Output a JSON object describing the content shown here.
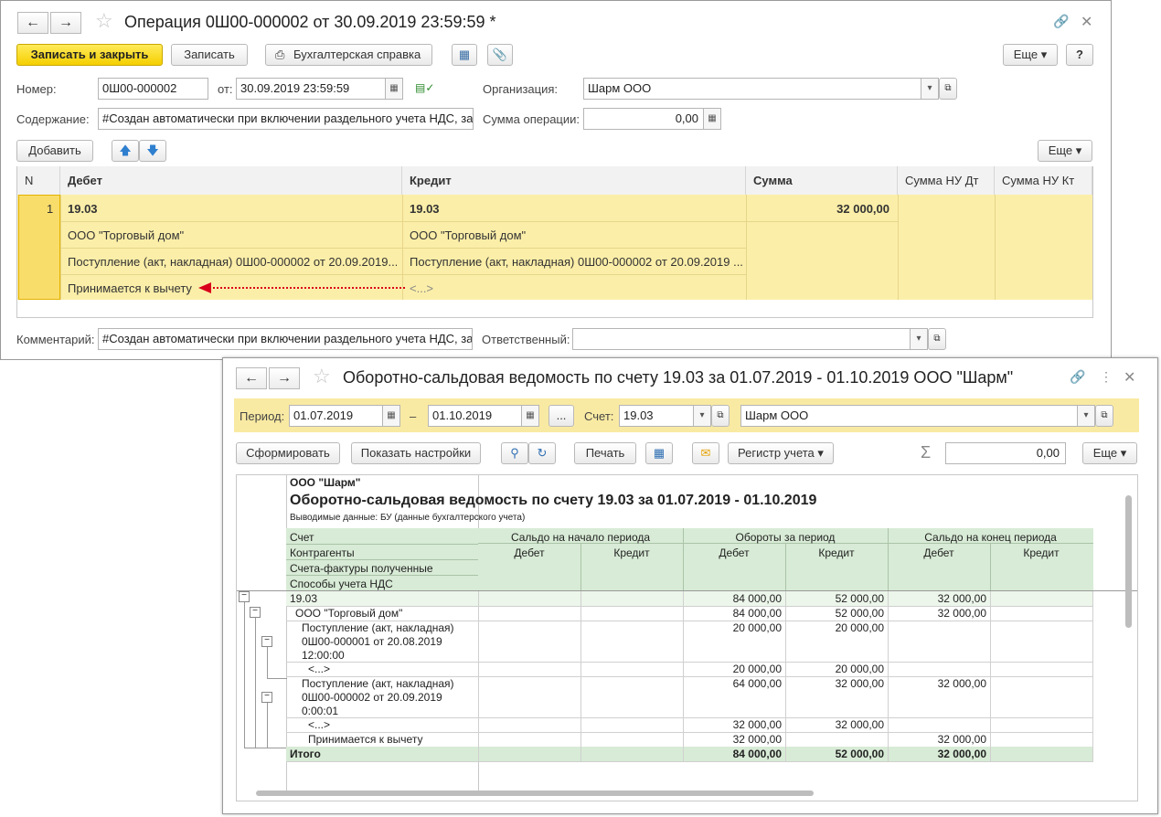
{
  "doc": {
    "title": "Операция 0Ш00-000002 от 30.09.2019 23:59:59 *",
    "toolbar": {
      "save_close": "Записать и закрыть",
      "save": "Записать",
      "report": "Бухгалтерская справка",
      "more": "Еще",
      "help": "?"
    },
    "number_label": "Номер:",
    "number": "0Ш00-000002",
    "from_label": "от:",
    "date": "30.09.2019 23:59:59",
    "org_label": "Организация:",
    "org": "Шарм ООО",
    "content_label": "Содержание:",
    "content": "#Создан автоматически при включении раздельного учета НДС, за",
    "sum_label": "Сумма операции:",
    "sum": "0,00",
    "add": "Добавить",
    "more2": "Еще",
    "columns": [
      "N",
      "Дебет",
      "Кредит",
      "Сумма",
      "Сумма НУ Дт",
      "Сумма НУ Кт"
    ],
    "row": {
      "n": "1",
      "debit_account": "19.03",
      "credit_account": "19.03",
      "amount": "32 000,00",
      "debit_sub1": "ООО \"Торговый дом\"",
      "credit_sub1": "ООО \"Торговый дом\"",
      "debit_sub2": "Поступление (акт, накладная) 0Ш00-000002 от 20.09.2019...",
      "credit_sub2": "Поступление (акт, накладная) 0Ш00-000002 от 20.09.2019 ...",
      "debit_sub3": "Принимается к вычету",
      "credit_sub3": "<...>"
    },
    "comment_label": "Комментарий:",
    "comment": "#Создан автоматически при включении раздельного учета НДС, за",
    "responsible_label": "Ответственный:",
    "responsible": ""
  },
  "report": {
    "title": "Оборотно-сальдовая ведомость по счету 19.03 за 01.07.2019 - 01.10.2019 ООО \"Шарм\"",
    "period_label": "Период:",
    "date_from": "01.07.2019",
    "dash": "–",
    "dots": "...",
    "account_label": "Счет:",
    "account": "19.03",
    "org": "Шарм ООО",
    "generate": "Сформировать",
    "settings": "Показать настройки",
    "print": "Печать",
    "register": "Регистр учета",
    "sigma": "Σ",
    "sum_value": "0,00",
    "more": "Еще",
    "date_to": "01.10.2019",
    "company": "ООО \"Шарм\"",
    "heading": "Оборотно-сальдовая ведомость по счету 19.03 за 01.07.2019 - 01.10.2019",
    "output": "Выводимые данные:  БУ (данные бухгалтерского учета)",
    "left_headers": [
      "Счет",
      "Контрагенты",
      "Счета-фактуры полученные",
      "Способы учета НДС"
    ],
    "groups": [
      "Сальдо на начало периода",
      "Обороты за период",
      "Сальдо на конец периода"
    ],
    "sub": [
      "Дебет",
      "Кредит",
      "Дебет",
      "Кредит",
      "Дебет",
      "Кредит"
    ],
    "rows": [
      {
        "label": "19.03",
        "v": [
          "",
          "",
          "84 000,00",
          "52 000,00",
          "32 000,00",
          ""
        ]
      },
      {
        "label": "ООО \"Торговый дом\"",
        "v": [
          "",
          "",
          "84 000,00",
          "52 000,00",
          "32 000,00",
          ""
        ]
      },
      {
        "label": "Поступление (акт, накладная)",
        "label2": "0Ш00-000001 от 20.08.2019",
        "label3": "12:00:00",
        "v": [
          "",
          "",
          "20 000,00",
          "20 000,00",
          "",
          ""
        ]
      },
      {
        "label": "<...>",
        "v": [
          "",
          "",
          "20 000,00",
          "20 000,00",
          "",
          ""
        ]
      },
      {
        "label": "Поступление (акт, накладная)",
        "label2": "0Ш00-000002 от 20.09.2019",
        "label3": "0:00:01",
        "v": [
          "",
          "",
          "64 000,00",
          "32 000,00",
          "32 000,00",
          ""
        ]
      },
      {
        "label": "<...>",
        "v": [
          "",
          "",
          "32 000,00",
          "32 000,00",
          "",
          ""
        ]
      },
      {
        "label": "Принимается к вычету",
        "v": [
          "",
          "",
          "32 000,00",
          "",
          "32 000,00",
          ""
        ]
      },
      {
        "label": "Итого",
        "v": [
          "",
          "",
          "84 000,00",
          "52 000,00",
          "32 000,00",
          ""
        ]
      }
    ]
  },
  "colors": {
    "accent_yellow": "#f5cf00",
    "row_highlight": "#fbeea8",
    "report_header": "#d8ebd6",
    "arrow": "#d9001b"
  }
}
